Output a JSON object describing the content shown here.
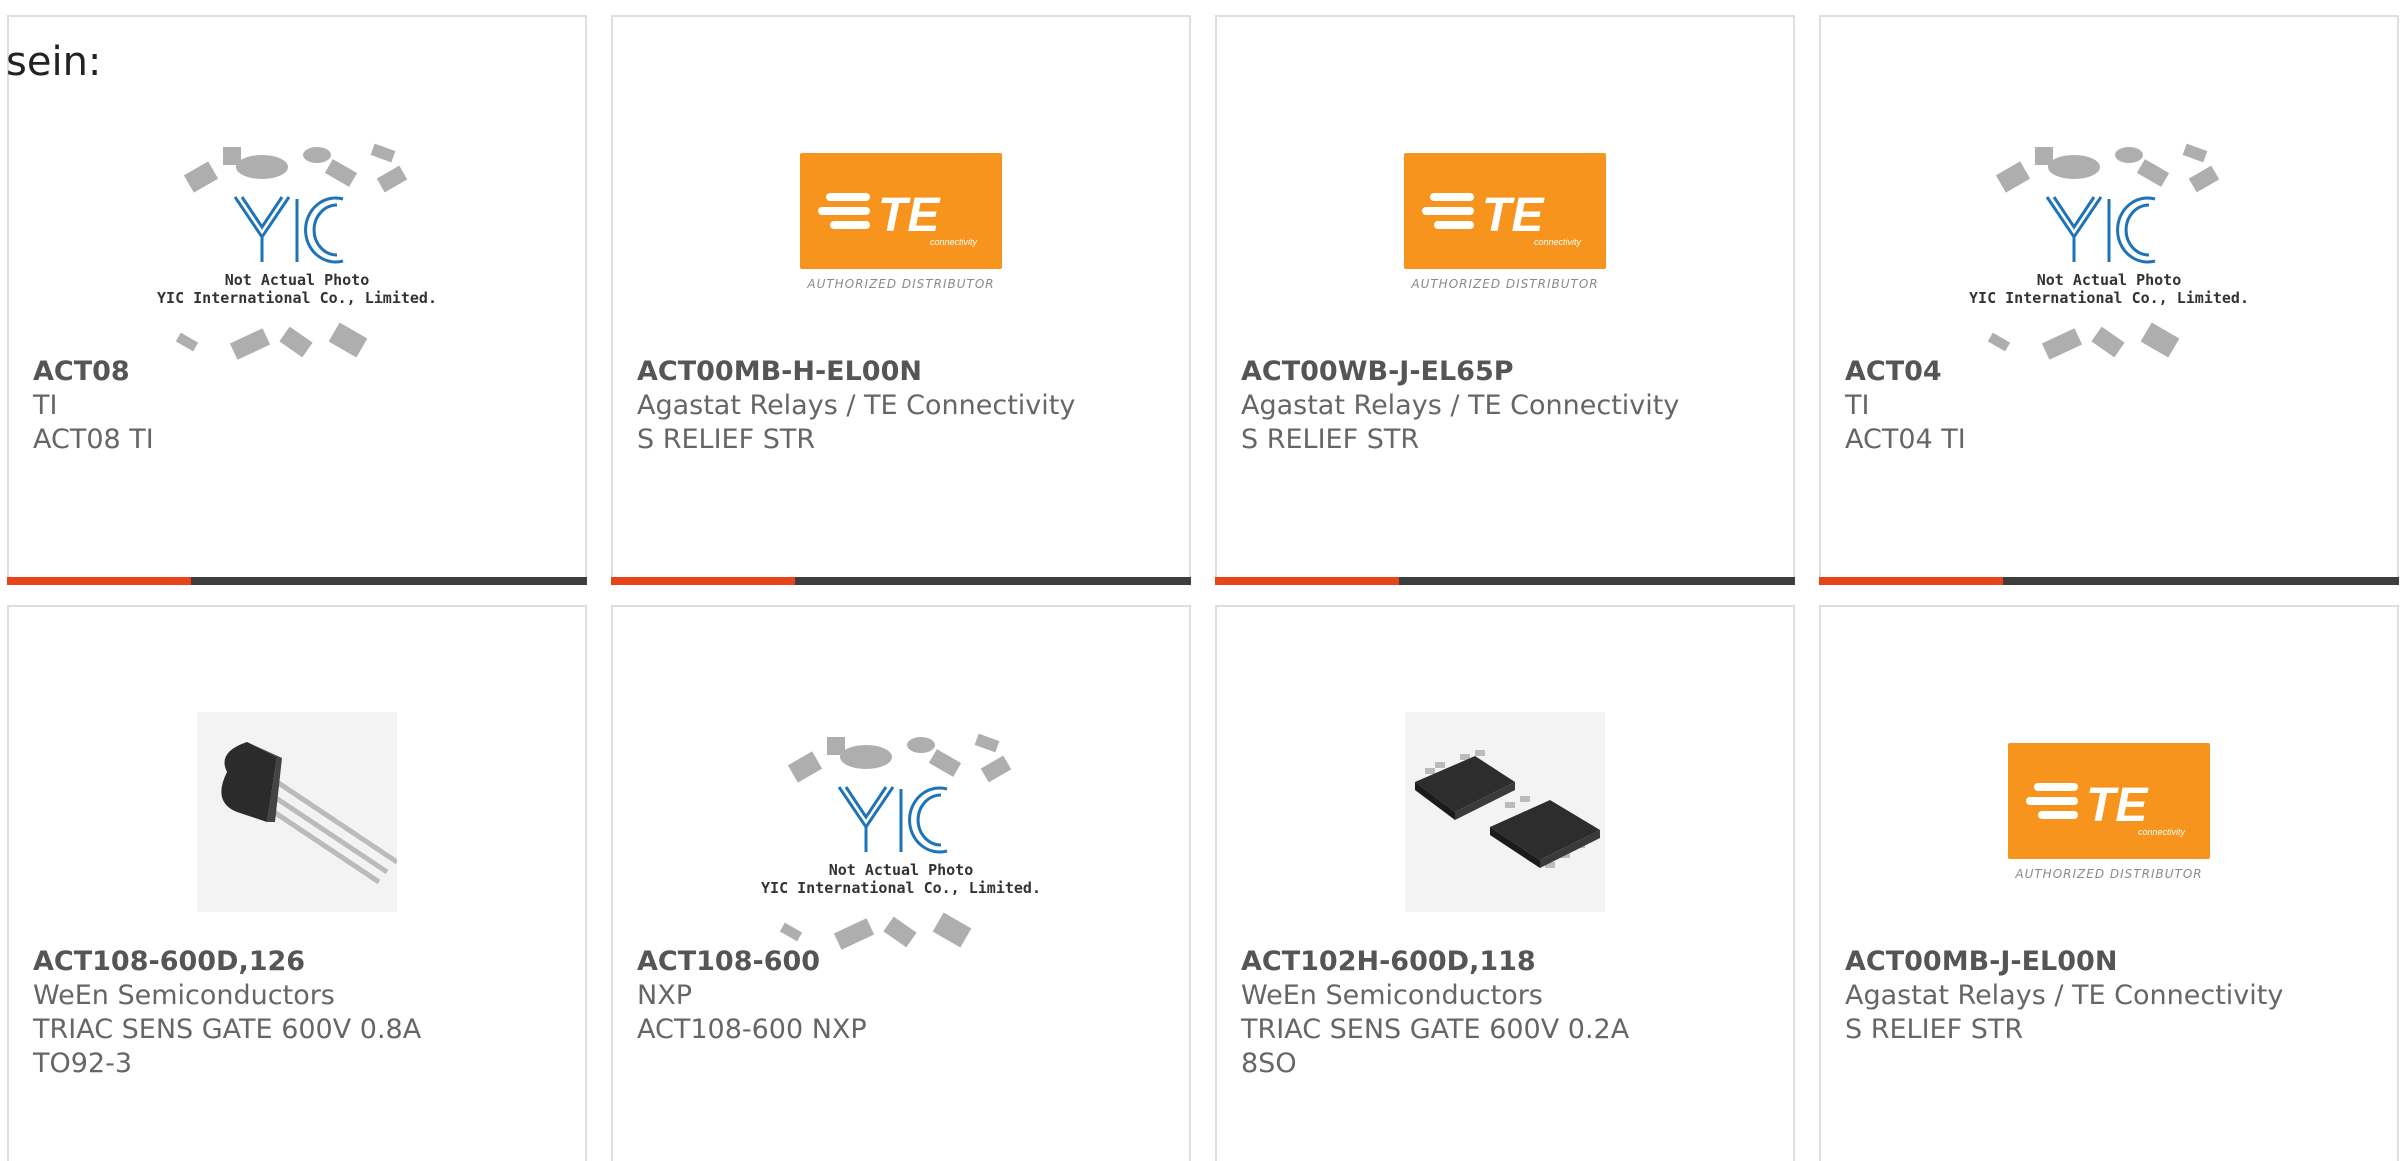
{
  "header": {
    "label": "sein:"
  },
  "colors": {
    "accent": "#e8441a",
    "bar": "#3d3d3d",
    "te_orange": "#f7941d",
    "yic_blue": "#1f73b7"
  },
  "te_logo": {
    "text": "TE",
    "sub": "connectivity",
    "distributor": "AUTHORIZED DISTRIBUTOR"
  },
  "yic_logo": {
    "text": "YIC",
    "line1": "Not Actual Photo",
    "line2": "YIC International Co., Limited."
  },
  "products": [
    {
      "part": "ACT08",
      "maker": "TI",
      "desc": "ACT08 TI",
      "desc2": "",
      "image": "yic-placeholder"
    },
    {
      "part": "ACT00MB-H-EL00N",
      "maker": "Agastat Relays / TE Connectivity",
      "desc": "S RELIEF STR",
      "desc2": "",
      "image": "te-logo"
    },
    {
      "part": "ACT00WB-J-EL65P",
      "maker": "Agastat Relays / TE Connectivity",
      "desc": "S RELIEF STR",
      "desc2": "",
      "image": "te-logo"
    },
    {
      "part": "ACT04",
      "maker": "TI",
      "desc": "ACT04 TI",
      "desc2": "",
      "image": "yic-placeholder"
    },
    {
      "part": "ACT108-600D,126",
      "maker": "WeEn Semiconductors",
      "desc": "TRIAC SENS GATE 600V 0.8A",
      "desc2": "TO92-3",
      "image": "to92-package"
    },
    {
      "part": "ACT108-600",
      "maker": "NXP",
      "desc": "ACT108-600 NXP",
      "desc2": "",
      "image": "yic-placeholder"
    },
    {
      "part": "ACT102H-600D,118",
      "maker": "WeEn Semiconductors",
      "desc": "TRIAC SENS GATE 600V 0.2A",
      "desc2": "8SO",
      "image": "so8-package"
    },
    {
      "part": "ACT00MB-J-EL00N",
      "maker": "Agastat Relays / TE Connectivity",
      "desc": "S RELIEF STR",
      "desc2": "",
      "image": "te-logo"
    }
  ]
}
